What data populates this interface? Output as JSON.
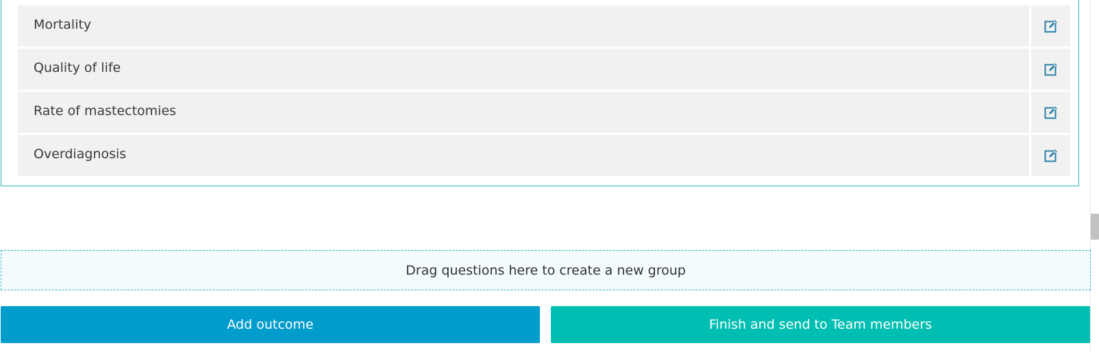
{
  "outcomes": [
    {
      "label": "Mortality"
    },
    {
      "label": "Quality of life"
    },
    {
      "label": "Rate of mastectomies"
    },
    {
      "label": "Overdiagnosis"
    }
  ],
  "edit_icon": "edit-icon",
  "dropzone": {
    "text": "Drag questions here to create a new group"
  },
  "buttons": {
    "add_outcome": "Add outcome",
    "finish": "Finish and send to Team members"
  },
  "colors": {
    "accent_border": "#2bb3c0",
    "add_button": "#009ccb",
    "finish_button": "#00bfb2",
    "icon": "#2a7fa8"
  }
}
